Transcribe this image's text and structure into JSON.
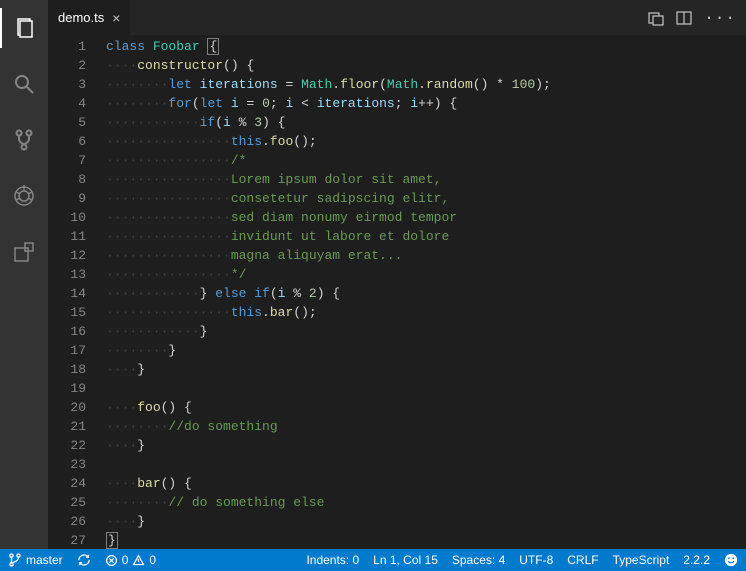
{
  "tab": {
    "filename": "demo.ts"
  },
  "gutter": {
    "count": 27
  },
  "code": {
    "lines": [
      {
        "n": 1,
        "indent": "",
        "tokens": [
          [
            "kw",
            "class "
          ],
          [
            "type",
            "Foobar"
          ],
          [
            "pn",
            " "
          ],
          [
            "cursorbox",
            "{"
          ]
        ]
      },
      {
        "n": 2,
        "indent": "····",
        "tokens": [
          [
            "fn",
            "constructor"
          ],
          [
            "pn",
            "() {"
          ]
        ]
      },
      {
        "n": 3,
        "indent": "········",
        "tokens": [
          [
            "kw",
            "let "
          ],
          [
            "var",
            "iterations"
          ],
          [
            "op",
            " = "
          ],
          [
            "obj",
            "Math"
          ],
          [
            "pn",
            "."
          ],
          [
            "fn",
            "floor"
          ],
          [
            "pn",
            "("
          ],
          [
            "obj",
            "Math"
          ],
          [
            "pn",
            "."
          ],
          [
            "fn",
            "random"
          ],
          [
            "pn",
            "() * "
          ],
          [
            "num",
            "100"
          ],
          [
            "pn",
            ");"
          ]
        ]
      },
      {
        "n": 4,
        "indent": "········",
        "tokens": [
          [
            "kw",
            "for"
          ],
          [
            "pn",
            "("
          ],
          [
            "kw",
            "let "
          ],
          [
            "var",
            "i"
          ],
          [
            "op",
            " = "
          ],
          [
            "num",
            "0"
          ],
          [
            "pn",
            "; "
          ],
          [
            "var",
            "i"
          ],
          [
            "op",
            " < "
          ],
          [
            "var",
            "iterations"
          ],
          [
            "pn",
            "; "
          ],
          [
            "var",
            "i"
          ],
          [
            "op",
            "++"
          ],
          [
            "pn",
            ") {"
          ]
        ]
      },
      {
        "n": 5,
        "indent": "············",
        "tokens": [
          [
            "kw",
            "if"
          ],
          [
            "pn",
            "("
          ],
          [
            "var",
            "i"
          ],
          [
            "op",
            " % "
          ],
          [
            "num",
            "3"
          ],
          [
            "pn",
            ") {"
          ]
        ]
      },
      {
        "n": 6,
        "indent": "················",
        "tokens": [
          [
            "this",
            "this"
          ],
          [
            "pn",
            "."
          ],
          [
            "fn",
            "foo"
          ],
          [
            "pn",
            "();"
          ]
        ]
      },
      {
        "n": 7,
        "indent": "················",
        "tokens": [
          [
            "cmt",
            "/*"
          ]
        ]
      },
      {
        "n": 8,
        "indent": "················",
        "tokens": [
          [
            "cmt",
            "Lorem ipsum dolor sit amet,"
          ]
        ]
      },
      {
        "n": 9,
        "indent": "················",
        "tokens": [
          [
            "cmt",
            "consetetur sadipscing elitr,"
          ]
        ]
      },
      {
        "n": 10,
        "indent": "················",
        "tokens": [
          [
            "cmt",
            "sed diam nonumy eirmod tempor"
          ]
        ]
      },
      {
        "n": 11,
        "indent": "················",
        "tokens": [
          [
            "cmt",
            "invidunt ut labore et dolore"
          ]
        ]
      },
      {
        "n": 12,
        "indent": "················",
        "tokens": [
          [
            "cmt",
            "magna aliquyam erat..."
          ]
        ]
      },
      {
        "n": 13,
        "indent": "················",
        "tokens": [
          [
            "cmt",
            "*/"
          ]
        ]
      },
      {
        "n": 14,
        "indent": "············",
        "tokens": [
          [
            "pn",
            "} "
          ],
          [
            "kw",
            "else if"
          ],
          [
            "pn",
            "("
          ],
          [
            "var",
            "i"
          ],
          [
            "op",
            " % "
          ],
          [
            "num",
            "2"
          ],
          [
            "pn",
            ") {"
          ]
        ]
      },
      {
        "n": 15,
        "indent": "················",
        "tokens": [
          [
            "this",
            "this"
          ],
          [
            "pn",
            "."
          ],
          [
            "fn",
            "bar"
          ],
          [
            "pn",
            "();"
          ]
        ]
      },
      {
        "n": 16,
        "indent": "············",
        "tokens": [
          [
            "pn",
            "}"
          ]
        ]
      },
      {
        "n": 17,
        "indent": "········",
        "tokens": [
          [
            "pn",
            "}"
          ]
        ]
      },
      {
        "n": 18,
        "indent": "····",
        "tokens": [
          [
            "pn",
            "}"
          ]
        ]
      },
      {
        "n": 19,
        "indent": "",
        "tokens": []
      },
      {
        "n": 20,
        "indent": "····",
        "tokens": [
          [
            "fn",
            "foo"
          ],
          [
            "pn",
            "() {"
          ]
        ]
      },
      {
        "n": 21,
        "indent": "········",
        "tokens": [
          [
            "cmt",
            "//do something"
          ]
        ]
      },
      {
        "n": 22,
        "indent": "····",
        "tokens": [
          [
            "pn",
            "}"
          ]
        ]
      },
      {
        "n": 23,
        "indent": "",
        "tokens": []
      },
      {
        "n": 24,
        "indent": "····",
        "tokens": [
          [
            "fn",
            "bar"
          ],
          [
            "pn",
            "() {"
          ]
        ]
      },
      {
        "n": 25,
        "indent": "········",
        "tokens": [
          [
            "cmt",
            "// do something else"
          ]
        ]
      },
      {
        "n": 26,
        "indent": "····",
        "tokens": [
          [
            "pn",
            "}"
          ]
        ]
      },
      {
        "n": 27,
        "indent": "",
        "tokens": [
          [
            "matchbox",
            "}"
          ]
        ]
      }
    ]
  },
  "status": {
    "branch": "master",
    "errors": "0",
    "warnings": "0",
    "indents": "Indents: 0",
    "position": "Ln 1, Col 15",
    "spaces": "Spaces: 4",
    "encoding": "UTF-8",
    "eol": "CRLF",
    "language": "TypeScript",
    "version": "2.2.2"
  }
}
